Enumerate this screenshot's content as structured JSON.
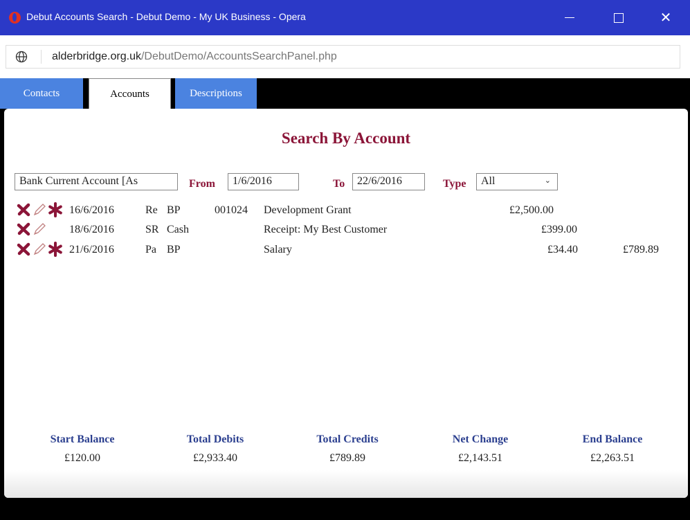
{
  "window": {
    "title": "Debut Accounts Search - Debut Demo - My UK Business - Opera",
    "url_host": "alderbridge.org.uk",
    "url_path": "/DebutDemo/AccountsSearchPanel.php"
  },
  "tabs": [
    {
      "label": "Contacts",
      "active": false
    },
    {
      "label": "Accounts",
      "active": true
    },
    {
      "label": "Descriptions",
      "active": false
    }
  ],
  "search": {
    "heading": "Search By Account",
    "account_value": "Bank Current Account [As",
    "from_label": "From",
    "from_value": "1/6/2016",
    "to_label": "To",
    "to_value": "22/6/2016",
    "type_label": "Type",
    "type_value": "All"
  },
  "rows": [
    {
      "date": "16/6/2016",
      "type": "Re",
      "ref": "BP",
      "num": "001024",
      "desc": "Development Grant",
      "debit": "£2,500.00",
      "credit": "",
      "has_star": true
    },
    {
      "date": "18/6/2016",
      "type": "SR",
      "ref": "Cash",
      "num": "",
      "desc": "Receipt: My Best Customer",
      "debit": "£399.00",
      "credit": "",
      "has_star": false
    },
    {
      "date": "21/6/2016",
      "type": "Pa",
      "ref": "BP",
      "num": "",
      "desc": "Salary",
      "debit": "£34.40",
      "credit": "£789.89",
      "has_star": true
    }
  ],
  "summary": {
    "start_balance_label": "Start Balance",
    "start_balance": "£120.00",
    "total_debits_label": "Total Debits",
    "total_debits": "£2,933.40",
    "total_credits_label": "Total Credits",
    "total_credits": "£789.89",
    "net_change_label": "Net Change",
    "net_change": "£2,143.51",
    "end_balance_label": "End Balance",
    "end_balance": "£2,263.51"
  },
  "icons": {
    "delete": "delete-x-icon",
    "edit": "pencil-edit-icon",
    "star": "asterisk-icon"
  },
  "colors": {
    "titlebar": "#2b39c7",
    "tab_inactive": "#4b83e0",
    "accent": "#8b1538",
    "summary_heading": "#2b3f8f"
  }
}
